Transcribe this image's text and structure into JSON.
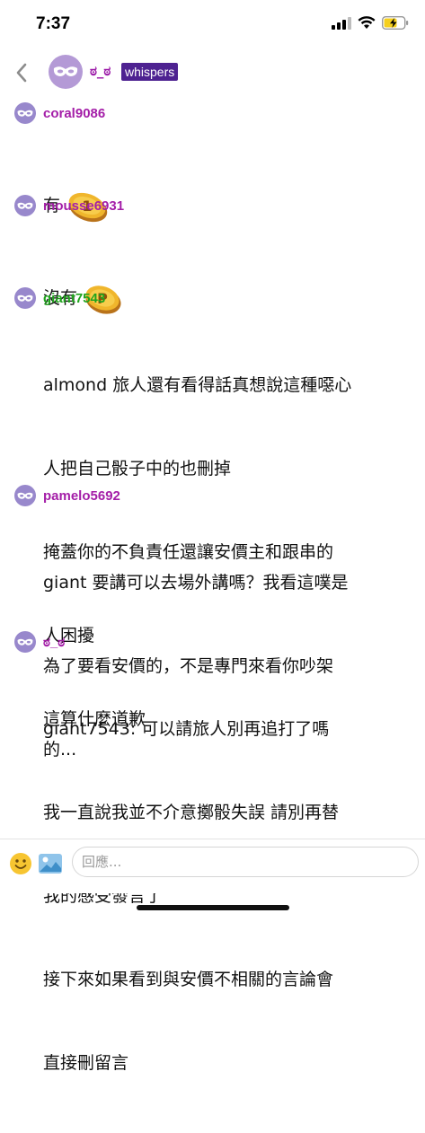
{
  "status_bar": {
    "time": "7:37"
  },
  "header": {
    "name": "ಠ_ಠ",
    "badge": "whispers"
  },
  "colors": {
    "badge_bg": "#4e2291",
    "header_name": "#9b1aa8",
    "avatar": "#b49ad6"
  },
  "messages": [
    {
      "username": "coral9086",
      "color": "#a41ea8",
      "lines": [
        "有"
      ],
      "emote": "coin-1-emote"
    },
    {
      "username": "mousse6931",
      "color": "#a41ea8",
      "lines": [
        "沒有"
      ],
      "emote": "coin-p-emote"
    },
    {
      "username": "giant7543",
      "color": "#1fa31c",
      "lines": [
        "almond 旅人還有看得話真想說這種噁心",
        "人把自己骰子中的也刪掉",
        "掩蓋你的不負責任還讓安價主和跟串的",
        "人困擾",
        "這算什麼道歉"
      ]
    },
    {
      "username": "pamelo5692",
      "color": "#a41ea8",
      "lines": [
        "giant 要講可以去場外講嗎？我看這噗是",
        "為了要看安價的，不是專門來看你吵架",
        "的..."
      ]
    },
    {
      "username": "ಠ_ಠ",
      "color": "#a41ea8",
      "lines": [
        "giant7543: 可以請旅人別再追打了嗎",
        "我一直說我並不介意擲骰失誤 請別再替",
        "我的感受發言了",
        "接下來如果看到與安價不相關的言論會",
        "直接刪留言"
      ]
    }
  ],
  "input": {
    "placeholder": "回應..."
  }
}
